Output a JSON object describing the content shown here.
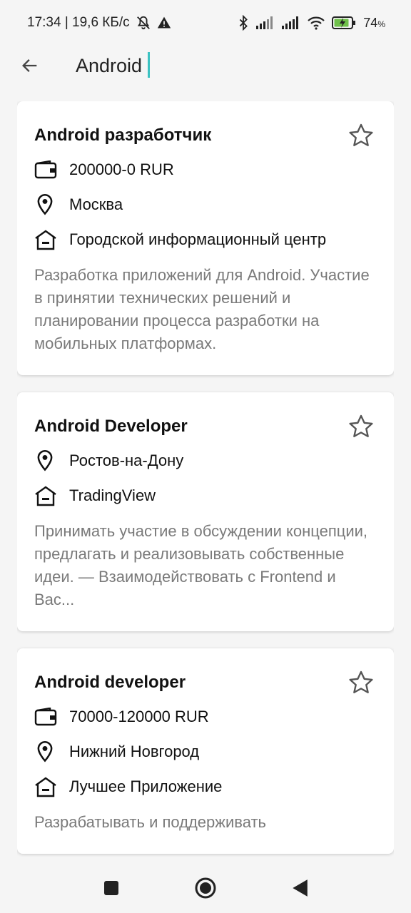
{
  "status_bar": {
    "time_speed": "17:34 | 19,6 КБ/с",
    "battery": "74",
    "icons": [
      "mute-icon",
      "warning-icon",
      "bluetooth-icon",
      "signal-icon",
      "signal-icon",
      "wifi-icon",
      "battery-charging-icon"
    ]
  },
  "search": {
    "value": "Android",
    "back_icon": "arrow-left-icon",
    "cursor_color": "#3cc2c2"
  },
  "results": [
    {
      "title": "Android разработчик",
      "salary": "200000-0 RUR",
      "city": "Москва",
      "company": "Городской информационный центр",
      "description": "Разработка приложений для Android. Участие в принятии технических решений и планировании процесса разработки на мобильных платформах."
    },
    {
      "title": "Android Developer",
      "salary": "",
      "city": "Ростов-на-Дону",
      "company": "TradingView",
      "description": "Принимать участие в обсуждении концепции, предлагать и реализовывать собственные идеи. — Взаимодействовать с Frontend и Bac..."
    },
    {
      "title": "Android developer",
      "salary": "70000-120000 RUR",
      "city": "Нижний Новгород",
      "company": "Лучшее Приложение",
      "description": "Разрабатывать и поддерживать"
    }
  ],
  "nav": {
    "icons": [
      "square-icon",
      "circle-home-icon",
      "triangle-back-icon"
    ]
  }
}
